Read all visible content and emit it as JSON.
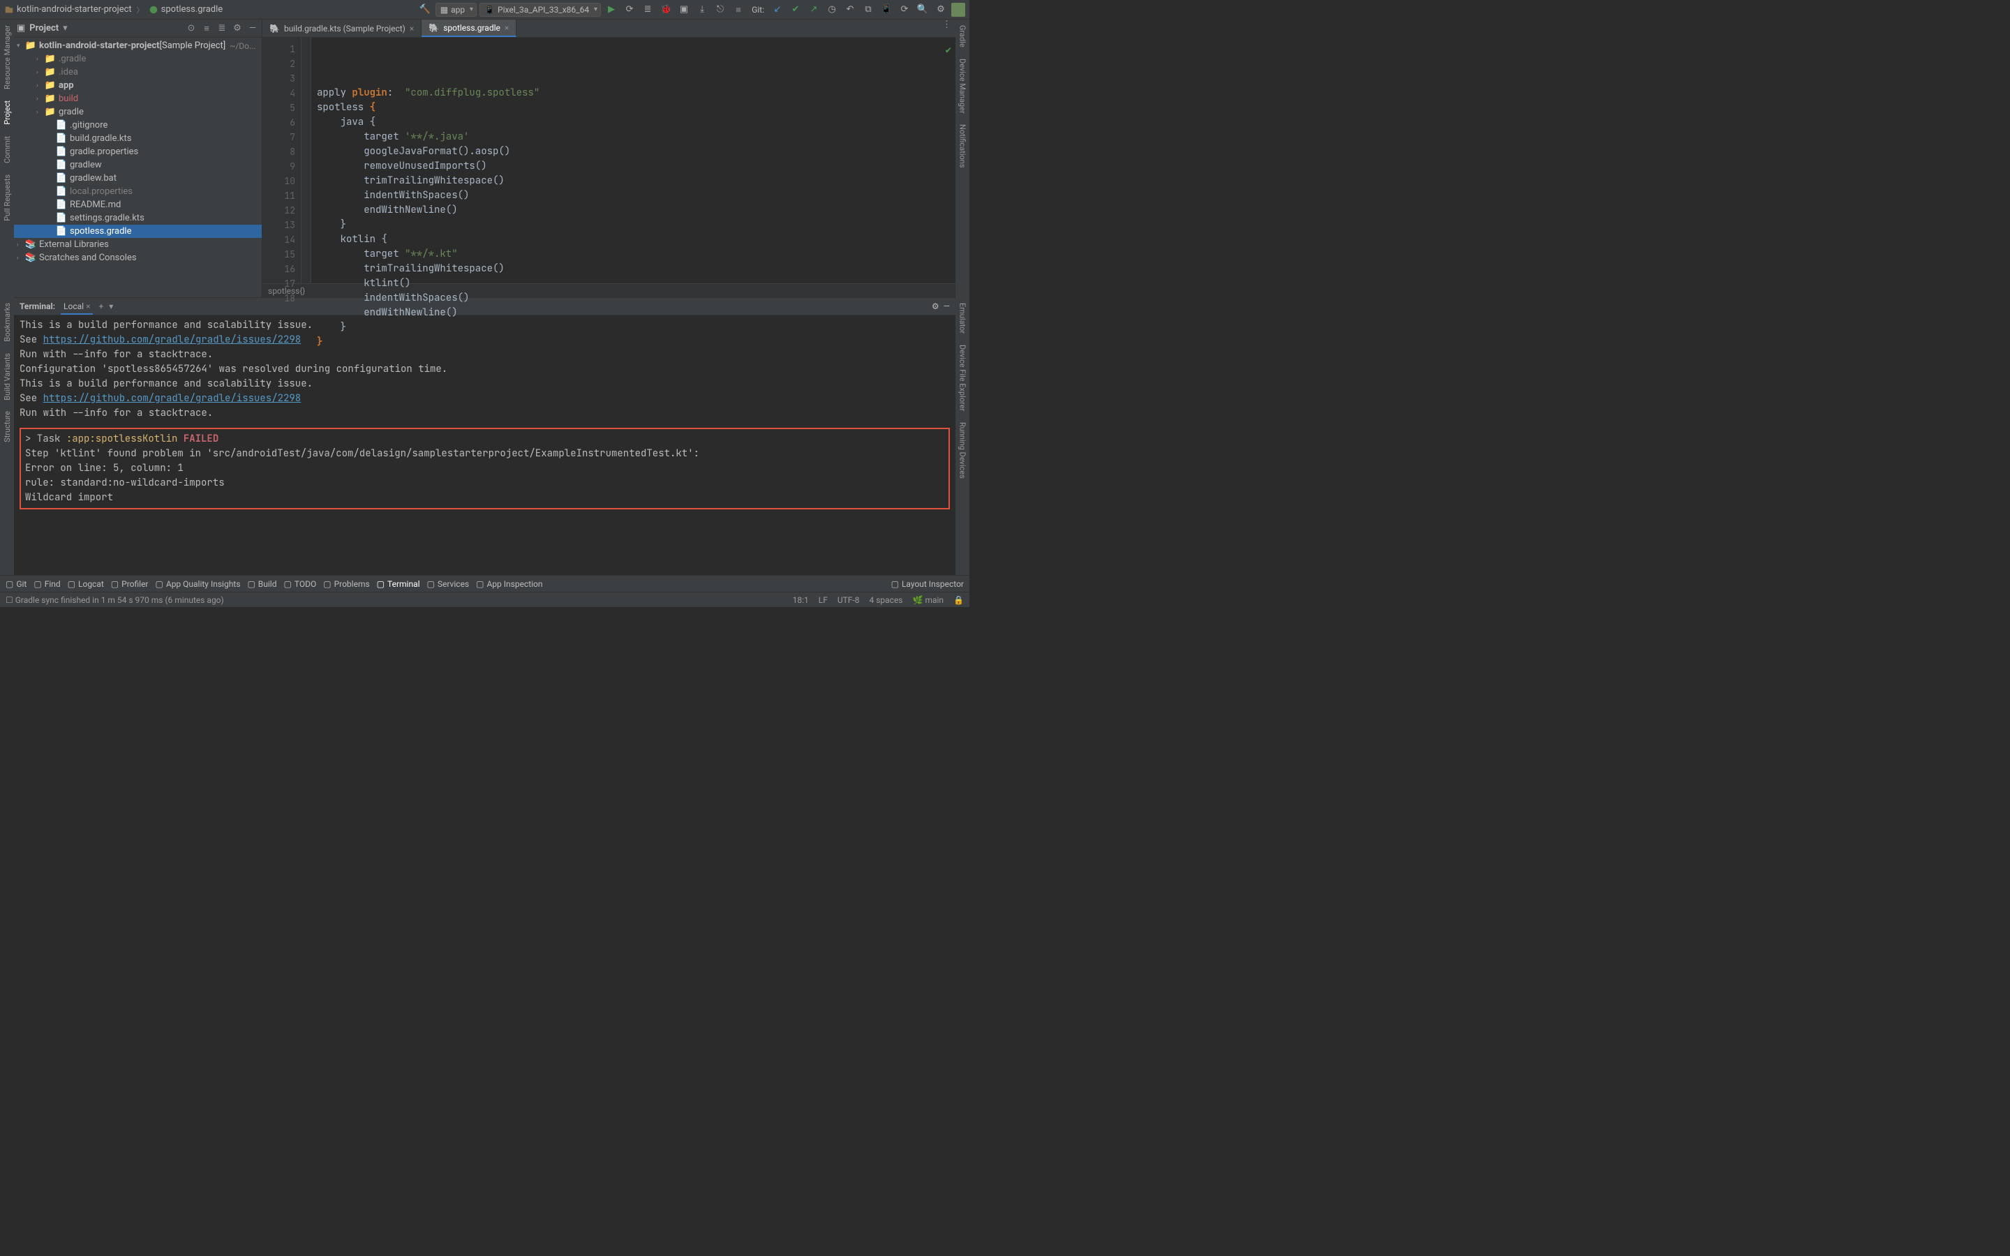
{
  "breadcrumb": {
    "root": "kotlin-android-starter-project",
    "file": "spotless.gradle"
  },
  "run_configs": {
    "app": "app",
    "device": "Pixel_3a_API_33_x86_64"
  },
  "git_label": "Git:",
  "left_rail": [
    "Resource Manager",
    "Project",
    "Commit",
    "Pull Requests",
    "Bookmarks",
    "Build Variants",
    "Structure"
  ],
  "right_rail": [
    "Gradle",
    "Device Manager",
    "Notifications",
    "Emulator",
    "Device File Explorer",
    "Running Devices"
  ],
  "project_panel": {
    "title": "Project",
    "root": {
      "name": "kotlin-android-starter-project",
      "suffix": "[Sample Project]",
      "hint": "~/Do..."
    },
    "children": [
      {
        "name": ".gradle",
        "indent": 2,
        "arrow": ">",
        "folder": true,
        "dim": true
      },
      {
        "name": ".idea",
        "indent": 2,
        "arrow": ">",
        "folder": true,
        "dim": true
      },
      {
        "name": "app",
        "indent": 2,
        "arrow": ">",
        "folder": true,
        "bold": true
      },
      {
        "name": "build",
        "indent": 2,
        "arrow": ">",
        "folder": true,
        "red": true
      },
      {
        "name": "gradle",
        "indent": 2,
        "arrow": ">",
        "folder": true
      },
      {
        "name": ".gitignore",
        "indent": 3,
        "folder": false
      },
      {
        "name": "build.gradle.kts",
        "indent": 3,
        "folder": false
      },
      {
        "name": "gradle.properties",
        "indent": 3,
        "folder": false
      },
      {
        "name": "gradlew",
        "indent": 3,
        "folder": false
      },
      {
        "name": "gradlew.bat",
        "indent": 3,
        "folder": false
      },
      {
        "name": "local.properties",
        "indent": 3,
        "folder": false,
        "dim": true
      },
      {
        "name": "README.md",
        "indent": 3,
        "folder": false
      },
      {
        "name": "settings.gradle.kts",
        "indent": 3,
        "folder": false
      },
      {
        "name": "spotless.gradle",
        "indent": 3,
        "folder": false,
        "selected": true
      }
    ],
    "extra_roots": [
      {
        "name": "External Libraries"
      },
      {
        "name": "Scratches and Consoles"
      }
    ]
  },
  "editor": {
    "tabs": [
      {
        "label": "build.gradle.kts (Sample Project)",
        "active": false
      },
      {
        "label": "spotless.gradle",
        "active": true
      }
    ],
    "breadcrumb": "spotless{}",
    "lines": [
      {
        "n": 1,
        "html": "apply <span class='kw'>plugin</span>:  <span class='str'>\"com.diffplug.spotless\"</span>"
      },
      {
        "n": 2,
        "html": "spotless <span class='kw'>{</span>"
      },
      {
        "n": 3,
        "html": "    java {"
      },
      {
        "n": 4,
        "html": "        target <span class='str'>'**/*.java'</span>"
      },
      {
        "n": 5,
        "html": "        googleJavaFormat().aosp()"
      },
      {
        "n": 6,
        "html": "        removeUnusedImports()"
      },
      {
        "n": 7,
        "html": "        trimTrailingWhitespace()"
      },
      {
        "n": 8,
        "html": "        indentWithSpaces()"
      },
      {
        "n": 9,
        "html": "        endWithNewline()"
      },
      {
        "n": 10,
        "html": "    }"
      },
      {
        "n": 11,
        "html": "    kotlin {"
      },
      {
        "n": 12,
        "html": "        target <span class='str'>\"**/*.kt\"</span>"
      },
      {
        "n": 13,
        "html": "        trimTrailingWhitespace()"
      },
      {
        "n": 14,
        "html": "        ktlint()"
      },
      {
        "n": 15,
        "html": "        indentWithSpaces()"
      },
      {
        "n": 16,
        "html": "        endWithNewline()"
      },
      {
        "n": 17,
        "html": "    }"
      },
      {
        "n": 18,
        "html": "<span class='kw'>}</span>"
      }
    ]
  },
  "terminal": {
    "title": "Terminal:",
    "tab": "Local",
    "lines": [
      "This is a build performance and scalability issue.",
      "See <a>https://github.com/gradle/gradle/issues/2298</a>",
      "Run with --info for a stacktrace.",
      "Configuration 'spotless865457264' was resolved during configuration time.",
      "This is a build performance and scalability issue.",
      "See <a>https://github.com/gradle/gradle/issues/2298</a>",
      "Run with --info for a stacktrace."
    ],
    "error": {
      "task_line_prefix": "> Task ",
      "task_name": ":app:spotlessKotlin",
      "task_status": " FAILED",
      "detail": [
        "Step 'ktlint' found problem in 'src/androidTest/java/com/delasign/samplestarterproject/ExampleInstrumentedTest.kt':",
        "Error on line: 5, column: 1",
        "rule: standard:no-wildcard-imports",
        "Wildcard import"
      ]
    }
  },
  "bottom_tools": [
    "Git",
    "Find",
    "Logcat",
    "Profiler",
    "App Quality Insights",
    "Build",
    "TODO",
    "Problems",
    "Terminal",
    "Services",
    "App Inspection"
  ],
  "bottom_tools_active": "Terminal",
  "bottom_right_tool": "Layout Inspector",
  "status": {
    "msg": "Gradle sync finished in 1 m 54 s 970 ms (6 minutes ago)",
    "pos": "18:1",
    "eol": "LF",
    "enc": "UTF-8",
    "indent": "4 spaces",
    "branch": "main"
  }
}
